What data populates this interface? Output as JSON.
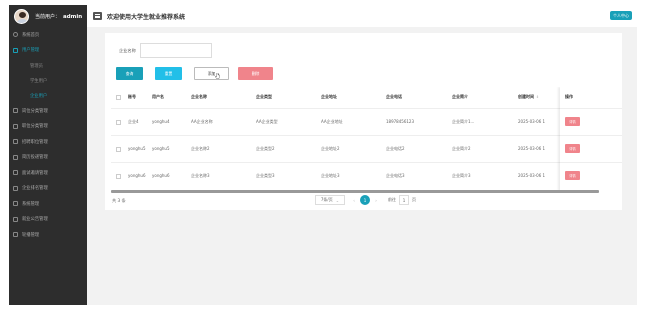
{
  "sidebar": {
    "user_label": "当前用户：",
    "username": "admin",
    "items": [
      {
        "label": "系统首页",
        "active": false,
        "sub": false
      },
      {
        "label": "用户管理",
        "active": true,
        "sub": false
      },
      {
        "label": "管理员",
        "active": false,
        "sub": true
      },
      {
        "label": "学生用户",
        "active": false,
        "sub": true
      },
      {
        "label": "企业用户",
        "active": true,
        "sub": true
      },
      {
        "label": "岗位分类管理",
        "active": false,
        "sub": false
      },
      {
        "label": "职位分类管理",
        "active": false,
        "sub": false
      },
      {
        "label": "招聘职位管理",
        "active": false,
        "sub": false
      },
      {
        "label": "简历投递管理",
        "active": false,
        "sub": false
      },
      {
        "label": "面试邀请管理",
        "active": false,
        "sub": false
      },
      {
        "label": "企业排名管理",
        "active": false,
        "sub": false
      },
      {
        "label": "系统管理",
        "active": false,
        "sub": false
      },
      {
        "label": "就业公告管理",
        "active": false,
        "sub": false
      },
      {
        "label": "轮播管理",
        "active": false,
        "sub": false
      }
    ]
  },
  "header": {
    "title": "欢迎使用大学生就业推荐系统",
    "personal_center": "个人中心"
  },
  "search": {
    "label": "企业名称",
    "value": "",
    "placeholder": ""
  },
  "buttons": {
    "query": "查询",
    "reset": "重置",
    "add": "添加",
    "delete": "删除"
  },
  "table": {
    "columns": [
      "账号",
      "用户名",
      "企业名称",
      "企业类型",
      "企业地址",
      "企业电话",
      "企业简介",
      "创建时间",
      "操作"
    ],
    "rows": [
      [
        "企业4",
        "yonghu4",
        "AA企业名称",
        "AA企业类型",
        "AA企业地址",
        "18978456123",
        "企业简介1...",
        "2025-03-06 1",
        "详情"
      ],
      [
        "yonghu5",
        "yonghu5",
        "企业名称2",
        "企业类型2",
        "企业地址2",
        "企业电话2",
        "企业简介2",
        "2025-03-06 1",
        "详情"
      ],
      [
        "yonghu6",
        "yonghu6",
        "企业名称3",
        "企业类型3",
        "企业地址3",
        "企业电话3",
        "企业简介3",
        "2025-03-06 1",
        "详情"
      ]
    ]
  },
  "pagination": {
    "total": "共 3 条",
    "page_size": "7条/页",
    "current_page": "1",
    "goto_label": "前往",
    "goto_value": "1",
    "page_unit": "页"
  },
  "colors": {
    "accent": "#19a0b8",
    "reset": "#22bfe8",
    "danger": "#f0848b",
    "sidebar_bg": "#2d2d2d"
  }
}
